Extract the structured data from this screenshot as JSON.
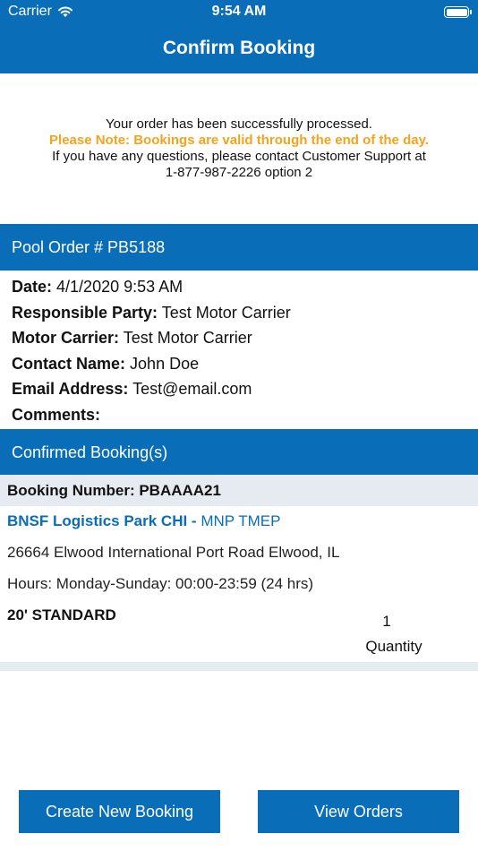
{
  "status_bar": {
    "carrier": "Carrier",
    "time": "9:54 AM"
  },
  "nav": {
    "title": "Confirm Booking"
  },
  "notice": {
    "line1": "Your order has been successfully processed.",
    "note": "Please Note: Bookings are valid through the end of the day.",
    "line3": "If you have any questions, please contact Customer Support at",
    "line4": "1-877-987-2226 option 2",
    "note_color": "#f2a41c"
  },
  "pool_order": {
    "title": "Pool Order # PB5188"
  },
  "details": {
    "date_label": "Date:",
    "date_value": "4/1/2020 9:53 AM",
    "party_label": "Responsible Party:",
    "party_value": "Test Motor Carrier",
    "carrier_label": "Motor Carrier:",
    "carrier_value": "Test Motor Carrier",
    "contact_label": "Contact Name:",
    "contact_value": "John Doe",
    "email_label": "Email Address:",
    "email_value": "Test@email.com",
    "comments_label": "Comments:",
    "comments_value": ""
  },
  "confirmed": {
    "title": "Confirmed Booking(s)",
    "booking_number": "Booking Number: PBAAAA21",
    "location_name": "BNSF Logistics Park CHI -",
    "location_code": "MNP TMEP",
    "address": "26664 Elwood International Port Road Elwood, IL",
    "hours": "Hours: Monday-Sunday: 00:00-23:59 (24 hrs)",
    "equipment": "20' STANDARD",
    "quantity_value": "1",
    "quantity_label": "Quantity"
  },
  "buttons": {
    "create": "Create New Booking",
    "orders": "View Orders"
  },
  "colors": {
    "primary": "#0a6db8",
    "row_background": "#e6ebf2"
  },
  "icons": [
    "wifi-icon",
    "battery-icon"
  ]
}
